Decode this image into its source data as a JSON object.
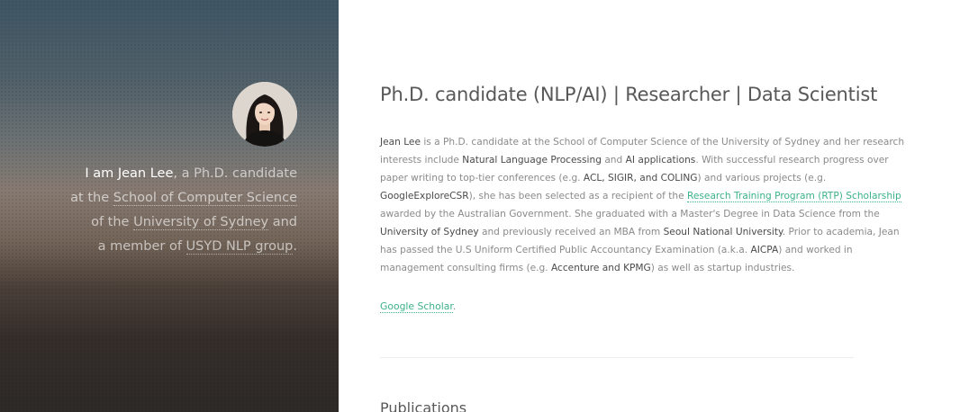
{
  "sidebar": {
    "avatar_alt": "Jean Lee",
    "intro": {
      "i_am": "I am Jean Lee",
      "comma_phd": ", a Ph.D. candidate",
      "at_the": "at the ",
      "school_link": "School of Computer Science",
      "of_the": "of the ",
      "university_link": "University of Sydney",
      "and": " and",
      "a_member_of": "a member of ",
      "group_link": "USYD NLP group",
      "period": "."
    }
  },
  "main": {
    "title": "Ph.D. candidate (NLP/AI) | Researcher | Data Scientist",
    "bio": {
      "l1_name": "Jean Lee",
      "l1_rest": " is a Ph.D. candidate at the School of Computer Science of the University of Sydney and her research",
      "l2_a": "interests include ",
      "l2_nlp": "Natural Language Processing",
      "l2_and": " and ",
      "l2_ai": "AI applications",
      "l2_rest": ". With successful research progress over",
      "l3_a": "paper writing to top-tier conferences (e.g. ",
      "l3_confs": "ACL, SIGIR, and COLING",
      "l3_rest": ") and various projects (e.g.",
      "l4_proj": "GoogleExploreCSR",
      "l4_mid": "), she has been selected as a recipient of the ",
      "l4_link": "Research Training Program (RTP) Scholarship",
      "l5": "awarded by the Australian Government. She graduated with a Master's Degree in Data Science from the",
      "l6_usyd": "University of Sydney",
      "l6_mid": " and previously received an MBA from ",
      "l6_snu": "Seoul National University",
      "l6_rest": ". Prior to academia, Jean",
      "l7_a": "has passed the U.S Uniform Certified Public Accountancy Examination (a.k.a. ",
      "l7_aicpa": "AICPA",
      "l7_rest": ") and worked in",
      "l8_a": "management consulting firms (e.g. ",
      "l8_firms": "Accenture and KPMG",
      "l8_rest": ") as well as startup industries."
    },
    "scholar_link": "Google Scholar",
    "scholar_period": ".",
    "publications_heading": "Publications"
  },
  "colors": {
    "accent_link": "#3bb18a",
    "title_text": "#585858",
    "body_text": "#8a8a8a",
    "sidebar_top": "#3f5665",
    "sidebar_bottom": "#2e2a28"
  }
}
